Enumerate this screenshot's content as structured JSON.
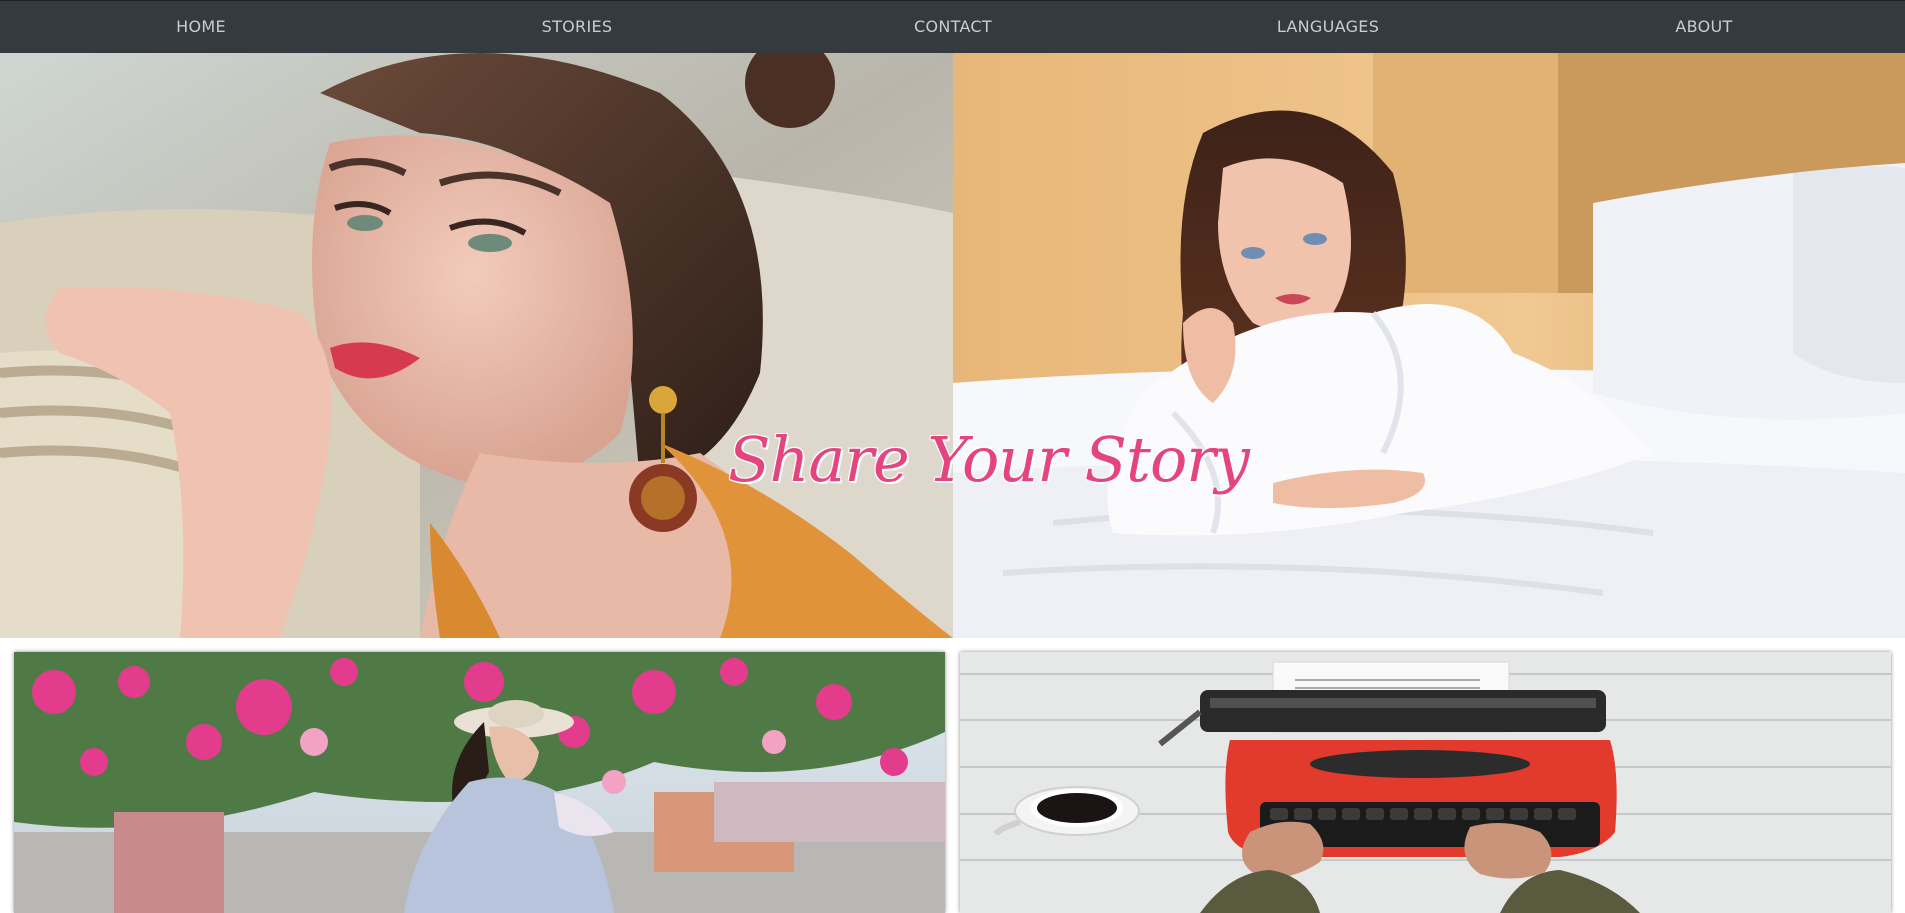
{
  "nav": {
    "items": [
      {
        "label": "HOME"
      },
      {
        "label": "STORIES"
      },
      {
        "label": "CONTACT"
      },
      {
        "label": "LANGUAGES"
      },
      {
        "label": "ABOUT"
      }
    ]
  },
  "hero": {
    "title": "Share Your Story",
    "title_color": "#e4457f"
  },
  "colors": {
    "nav_background": "#343a40",
    "nav_text": "#c9cdd1"
  }
}
